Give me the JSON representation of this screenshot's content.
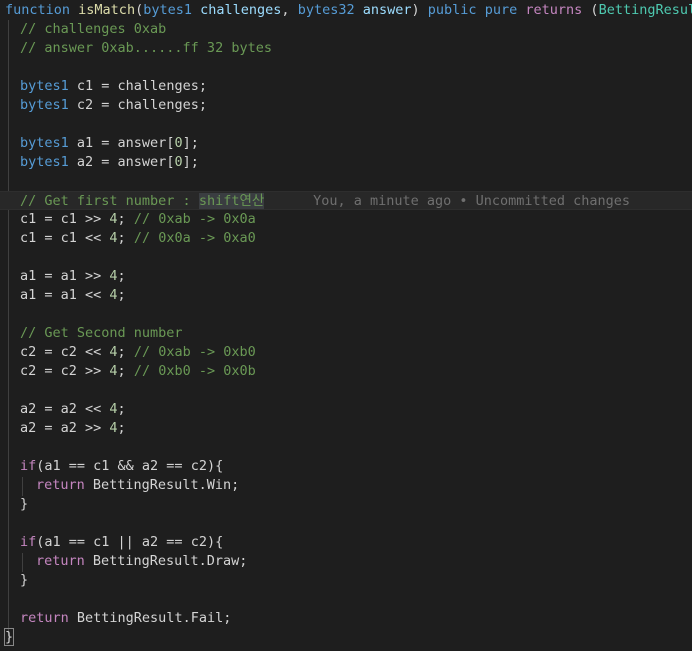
{
  "editor": {
    "header": {
      "kw_function": "function",
      "fn_name": "isMatch",
      "open_paren": "(",
      "type1": "bytes1",
      "param1": "challenges",
      "comma": ", ",
      "type2": "bytes32",
      "param2": "answer",
      "close_paren": ")",
      "kw_public": "public",
      "kw_pure": "pure",
      "kw_returns": "returns",
      "ret_open": "(",
      "ret_type": "BettingResult",
      "ret_close": ")",
      "brace_open": "{"
    },
    "comment1": "// challenges 0xab",
    "comment2": "// answer 0xab......ff 32 bytes",
    "c1_decl": {
      "type": "bytes1",
      "rest": " c1 = challenges;"
    },
    "c2_decl": {
      "type": "bytes1",
      "rest": " c2 = challenges;"
    },
    "a1_decl": {
      "type": "bytes1",
      "rest": " a1 = answer[",
      "idx": "0",
      "end": "];"
    },
    "a2_decl": {
      "type": "bytes1",
      "rest": " a2 = answer[",
      "idx": "0",
      "end": "];"
    },
    "comment_first": "// Get first number : ",
    "comment_first_hl": "shift연산",
    "blame": "You, a minute ago • Uncommitted changes",
    "c1_shift_r": {
      "code": "c1 = c1 >> ",
      "num": "4",
      "semi": "; ",
      "comment": "// 0xab -> 0x0a"
    },
    "c1_shift_l": {
      "code": "c1 = c1 << ",
      "num": "4",
      "semi": "; ",
      "comment": "// 0x0a -> 0xa0"
    },
    "a1_shift_r": {
      "code": "a1 = a1 >> ",
      "num": "4",
      "semi": ";"
    },
    "a1_shift_l": {
      "code": "a1 = a1 << ",
      "num": "4",
      "semi": ";"
    },
    "comment_second": "// Get Second number",
    "c2_shift_l": {
      "code": "c2 = c2 << ",
      "num": "4",
      "semi": "; ",
      "comment": "// 0xab -> 0xb0"
    },
    "c2_shift_r": {
      "code": "c2 = c2 >> ",
      "num": "4",
      "semi": "; ",
      "comment": "// 0xb0 -> 0x0b"
    },
    "a2_shift_l": {
      "code": "a2 = a2 << ",
      "num": "4",
      "semi": ";"
    },
    "a2_shift_r": {
      "code": "a2 = a2 >> ",
      "num": "4",
      "semi": ";"
    },
    "if_and": {
      "kw": "if",
      "cond": "(a1 == c1 && a2 == c2){"
    },
    "return_win": {
      "kw": "return",
      "value": " BettingResult.Win;"
    },
    "close_brace": "}",
    "if_or": {
      "kw": "if",
      "cond": "(a1 == c1 || a2 == c2){"
    },
    "return_draw": {
      "kw": "return",
      "value": " BettingResult.Draw;"
    },
    "return_fail": {
      "kw": "return",
      "value": " BettingResult.Fail;"
    },
    "final_brace": "}"
  }
}
